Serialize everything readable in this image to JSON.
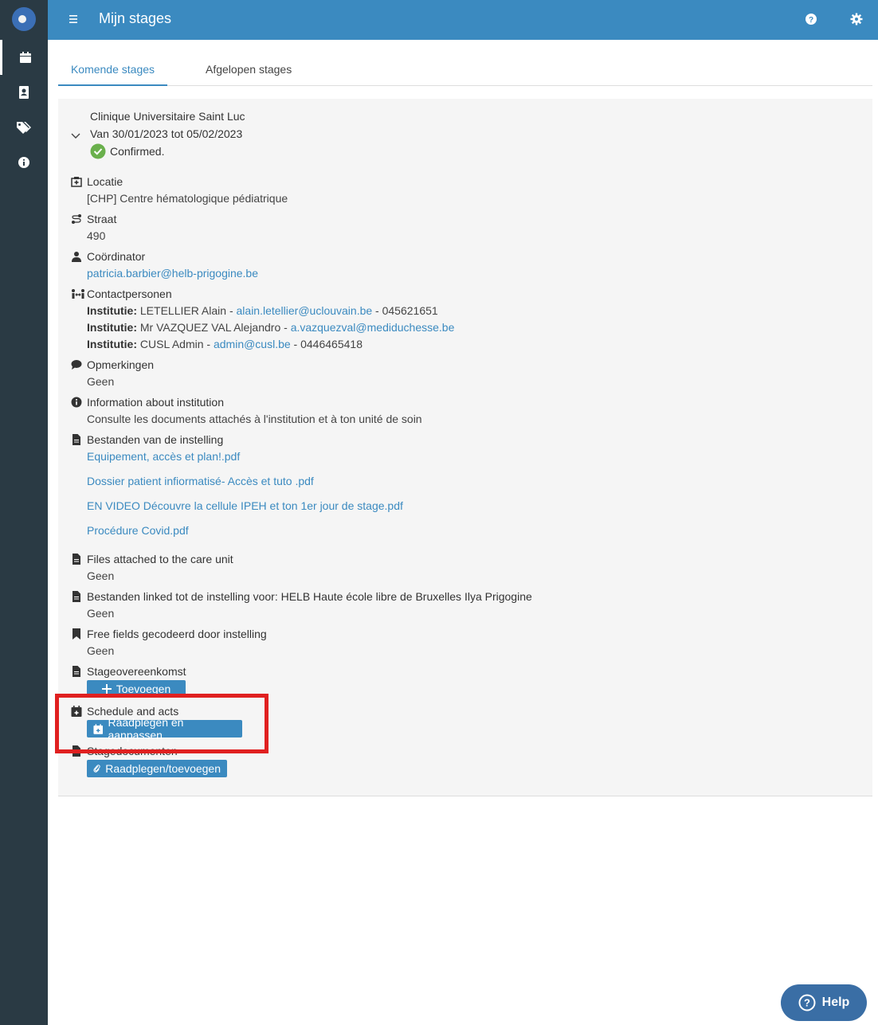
{
  "header": {
    "title": "Mijn stages"
  },
  "tabs": [
    {
      "label": "Komende stages",
      "active": true
    },
    {
      "label": "Afgelopen stages",
      "active": false
    }
  ],
  "stage": {
    "institution": "Clinique Universitaire Saint Luc",
    "period": "Van 30/01/2023 tot 05/02/2023",
    "status": "Confirmed.",
    "locatie_label": "Locatie",
    "locatie_value": "[CHP] Centre hématologique pédiatrique",
    "straat_label": "Straat",
    "straat_value": "490",
    "coordinator_label": "Coördinator",
    "coordinator_value": "patricia.barbier@helb-prigogine.be",
    "contacts_label": "Contactpersonen",
    "contacts": [
      {
        "prefix": "Institutie:",
        "name": " LETELLIER Alain - ",
        "email": "alain.letellier@uclouvain.be",
        "phone": " - 045621651"
      },
      {
        "prefix": "Institutie:",
        "name": " Mr VAZQUEZ VAL Alejandro - ",
        "email": "a.vazquezval@mediduchesse.be",
        "phone": ""
      },
      {
        "prefix": "Institutie:",
        "name": " CUSL Admin - ",
        "email": "admin@cusl.be",
        "phone": " - 0446465418"
      }
    ],
    "opmerkingen_label": "Opmerkingen",
    "opmerkingen_value": "Geen",
    "info_label": "Information about institution",
    "info_value": "Consulte les documents attachés à l'institution et à ton unité de soin",
    "bestanden_label": "Bestanden van de instelling",
    "files": [
      "Equipement, accès et plan!.pdf",
      "Dossier patient infiormatisé- Accès et tuto .pdf",
      "EN VIDEO Découvre la cellule IPEH et ton 1er jour de stage.pdf",
      "Procédure Covid.pdf"
    ],
    "care_unit_label": "Files attached to the care unit",
    "care_unit_value": "Geen",
    "linked_label": "Bestanden linked tot de instelling voor: HELB Haute école libre de Bruxelles Ilya Prigogine",
    "linked_value": "Geen",
    "free_fields_label": "Free fields gecodeerd door instelling",
    "free_fields_value": "Geen",
    "agreement_label": "Stageovereenkomst",
    "agreement_button": "Toevoegen",
    "schedule_label": "Schedule and acts",
    "schedule_button": "Raadplegen en aanpassen",
    "documents_label": "Stagedocumenten",
    "documents_button": "Raadplegen/toevoegen"
  },
  "help_button": "Help",
  "colors": {
    "sidebar": "#2a3a44",
    "header": "#3b8ac0",
    "accent": "#3b8ac0",
    "success": "#6ab04c",
    "highlight": "#e02020",
    "help_fab": "#3a6ea5"
  }
}
